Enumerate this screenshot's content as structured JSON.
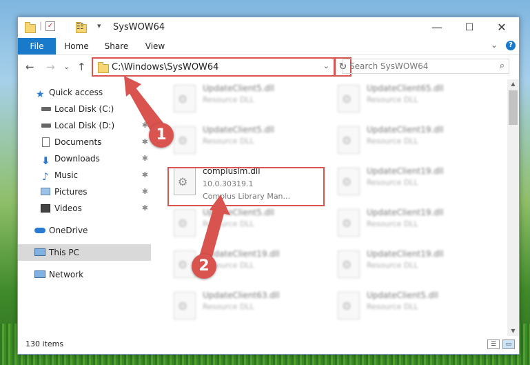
{
  "window": {
    "title": "SysWOW64"
  },
  "titlebar": {
    "dropdown_glyph": "▾"
  },
  "controls": {
    "minimize": "—",
    "maximize": "☐",
    "close": "✕"
  },
  "ribbon": {
    "tabs": [
      {
        "label": "File"
      },
      {
        "label": "Home"
      },
      {
        "label": "Share"
      },
      {
        "label": "View"
      }
    ],
    "expand_glyph": "⌄",
    "help_glyph": "?"
  },
  "address": {
    "path": "C:\\Windows\\SysWOW64",
    "back": "←",
    "forward": "→",
    "recent": "⌄",
    "up": "↑",
    "dropdown": "⌄",
    "refresh": "↻"
  },
  "search": {
    "placeholder": "Search SysWOW64",
    "icon": "⌕"
  },
  "nav": {
    "items": [
      {
        "label": "Quick access",
        "icon": "star-icon"
      },
      {
        "label": "Local Disk (C:)",
        "icon": "drive-icon",
        "pinned": true
      },
      {
        "label": "Local Disk (D:)",
        "icon": "drive-icon",
        "pinned": true
      },
      {
        "label": "Documents",
        "icon": "documents-icon",
        "pinned": true
      },
      {
        "label": "Downloads",
        "icon": "downloads-icon",
        "pinned": true
      },
      {
        "label": "Music",
        "icon": "music-icon",
        "pinned": true
      },
      {
        "label": "Pictures",
        "icon": "pictures-icon",
        "pinned": true
      },
      {
        "label": "Videos",
        "icon": "videos-icon",
        "pinned": true
      },
      {
        "label": "OneDrive",
        "icon": "onedrive-icon"
      },
      {
        "label": "This PC",
        "icon": "pc-icon",
        "selected": true
      },
      {
        "label": "Network",
        "icon": "network-icon"
      }
    ],
    "pin_glyph": "✱"
  },
  "files": [
    {
      "name": "UpdateClient5.dll",
      "desc": "Resource DLL"
    },
    {
      "name": "UpdateClient65.dll",
      "desc": "Resource DLL"
    },
    {
      "name": "UpdateClient5.dll",
      "desc": "Resource DLL"
    },
    {
      "name": "UpdateClient19.dll",
      "desc": "Resource DLL"
    },
    {
      "name": "UpdateClient19.dll",
      "desc": "Resource DLL"
    },
    {
      "name": "UpdateClient5.dll",
      "desc": "Resource DLL"
    },
    {
      "name": "UpdateClient19.dll",
      "desc": "Resource DLL"
    },
    {
      "name": "UpdateClient19.dll",
      "desc": "Resource DLL"
    },
    {
      "name": "UpdateClient19.dll",
      "desc": "Resource DLL"
    },
    {
      "name": "UpdateClient63.dll",
      "desc": "Resource DLL"
    },
    {
      "name": "UpdateClient5.dll",
      "desc": "Resource DLL"
    }
  ],
  "highlighted_file": {
    "name": "compluslm.dll",
    "version": "10.0.30319.1",
    "description": "Complus Library Man..."
  },
  "status": {
    "item_count": "130 items",
    "details_view": "☰",
    "tiles_view": "▭"
  },
  "scrollbar": {
    "up": "▲",
    "down": "▼"
  },
  "callouts": {
    "one": "1",
    "two": "2"
  },
  "colors": {
    "accent": "#1979ca",
    "highlight": "#d9534f",
    "selected": "#d9d9d9"
  }
}
